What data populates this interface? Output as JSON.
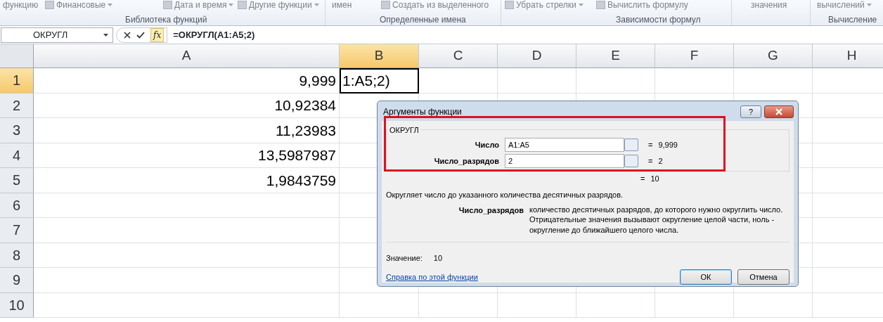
{
  "ribbon": {
    "items": [
      {
        "label": "функцию",
        "dropdown": false,
        "icon": false
      },
      {
        "label": "Финансовые",
        "dropdown": true,
        "icon": true
      },
      {
        "label": "Дата и время",
        "dropdown": true,
        "icon": true
      },
      {
        "label": "Другие функции",
        "dropdown": true,
        "icon": true
      },
      {
        "label": "имен",
        "dropdown": false,
        "icon": false
      },
      {
        "label": "Создать из выделенного",
        "dropdown": false,
        "icon": true
      },
      {
        "label": "Убрать стрелки",
        "dropdown": true,
        "icon": true
      },
      {
        "label": "Вычислить формулу",
        "dropdown": false,
        "icon": true
      },
      {
        "label": "значения",
        "dropdown": false,
        "icon": false
      },
      {
        "label": "вычислений",
        "dropdown": true,
        "icon": false
      }
    ],
    "groups": [
      "Библиотека функций",
      "Определенные имена",
      "Зависимости формул",
      "Вычисление"
    ]
  },
  "formula_bar": {
    "name_box": "ОКРУГЛ",
    "fx_label": "fx",
    "formula": "=ОКРУГЛ(A1:A5;2)"
  },
  "sheet": {
    "columns": [
      {
        "label": "A",
        "selected": false
      },
      {
        "label": "B",
        "selected": true
      },
      {
        "label": "C",
        "selected": false
      },
      {
        "label": "D",
        "selected": false
      },
      {
        "label": "E",
        "selected": false
      },
      {
        "label": "F",
        "selected": false
      },
      {
        "label": "G",
        "selected": false
      },
      {
        "label": "H",
        "selected": false
      }
    ],
    "rows": [
      {
        "label": "1",
        "selected": true,
        "cells": [
          "9,999",
          "1:A5;2)"
        ]
      },
      {
        "label": "2",
        "selected": false,
        "cells": [
          "10,92384",
          ""
        ]
      },
      {
        "label": "3",
        "selected": false,
        "cells": [
          "11,23983",
          ""
        ]
      },
      {
        "label": "4",
        "selected": false,
        "cells": [
          "13,5987987",
          ""
        ]
      },
      {
        "label": "5",
        "selected": false,
        "cells": [
          "1,9843759",
          ""
        ]
      },
      {
        "label": "6",
        "selected": false,
        "cells": [
          "",
          ""
        ]
      },
      {
        "label": "7",
        "selected": false,
        "cells": [
          "",
          ""
        ]
      },
      {
        "label": "8",
        "selected": false,
        "cells": [
          "",
          ""
        ]
      },
      {
        "label": "9",
        "selected": false,
        "cells": [
          "",
          ""
        ]
      },
      {
        "label": "10",
        "selected": false,
        "cells": [
          "",
          ""
        ]
      }
    ]
  },
  "dialog": {
    "title": "Аргументы функции",
    "help_button": "?",
    "function_name": "ОКРУГЛ",
    "args": [
      {
        "label": "Число",
        "value": "A1:A5",
        "equals": "=",
        "result": "9,999"
      },
      {
        "label": "Число_разрядов",
        "value": "2",
        "equals": "=",
        "result": "2"
      }
    ],
    "total_equals": "=",
    "total": "10",
    "description": "Округляет число до указанного количества десятичных разрядов.",
    "arg_help_name": "Число_разрядов",
    "arg_help_text": "количество десятичных разрядов, до которого нужно округлить число. Отрицательные значения вызывают округление целой части, ноль - округление до ближайшего целого числа.",
    "value_label": "Значение:",
    "value": "10",
    "help_link": "Справка по этой функции",
    "buttons": [
      {
        "label": "ОК",
        "default": true
      },
      {
        "label": "Отмена",
        "default": false
      }
    ]
  }
}
